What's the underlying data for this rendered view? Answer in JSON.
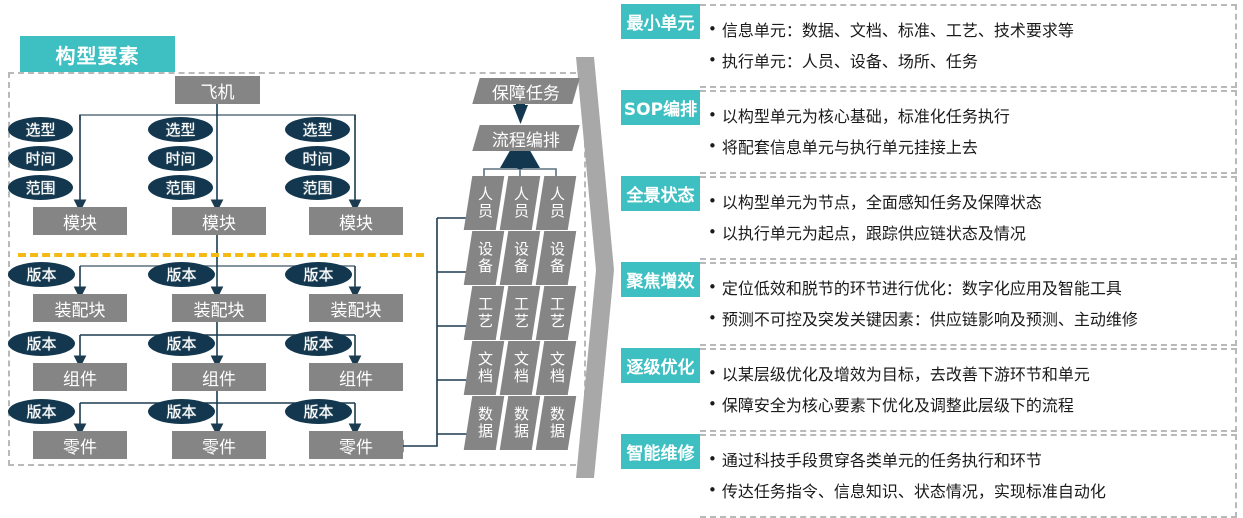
{
  "left_panel": {
    "title": "构型要素",
    "root": {
      "label": "飞机"
    },
    "attribute_labels": [
      "选型",
      "时间",
      "范围"
    ],
    "version_label": "版本",
    "levels": [
      {
        "name": "module-row",
        "label": "模块",
        "columns": [
          "模块",
          "模块",
          "模块"
        ]
      },
      {
        "name": "assembly-row",
        "label": "装配块",
        "columns": [
          "装配块",
          "装配块",
          "装配块"
        ]
      },
      {
        "name": "component-row",
        "label": "组件",
        "columns": [
          "组件",
          "组件",
          "组件"
        ]
      },
      {
        "name": "part-row",
        "label": "零件",
        "columns": [
          "零件",
          "零件",
          "零件"
        ]
      }
    ],
    "task_header": "保障任务",
    "process_header": "流程编排",
    "resource_stack": [
      "人员",
      "设备",
      "工艺",
      "文档",
      "数据"
    ],
    "resource_columns": 3
  },
  "right_panel": {
    "rows": [
      {
        "tag": "最小单元",
        "bullets": [
          "信息单元：数据、文档、标准、工艺、技术要求等",
          "执行单元：人员、设备、场所、任务"
        ]
      },
      {
        "tag": "SOP编排",
        "bullets": [
          "以构型单元为核心基础，标准化任务执行",
          "将配套信息单元与执行单元挂接上去"
        ]
      },
      {
        "tag": "全景状态",
        "bullets": [
          "以构型单元为节点，全面感知任务及保障状态",
          "以执行单元为起点，跟踪供应链状态及情况"
        ]
      },
      {
        "tag": "聚焦增效",
        "bullets": [
          "定位低效和脱节的环节进行优化：数字化应用及智能工具",
          "预测不可控及突发关键因素：供应链影响及预测、主动维修"
        ]
      },
      {
        "tag": "逐级优化",
        "bullets": [
          "以某层级优化及增效为目标，去改善下游环节和单元",
          "保障安全为核心要素下优化及调整此层级下的流程"
        ]
      },
      {
        "tag": "智能维修",
        "bullets": [
          "通过科技手段贯穿各类单元的任务执行和环节",
          "传达任务指令、信息知识、状态情况，实现标准自动化"
        ]
      }
    ],
    "bullet_glyph": "•"
  },
  "colors": {
    "accent_teal": "#3ebfc2",
    "node_navy": "#12374e",
    "box_gray": "#858585",
    "divider_yellow": "#f5b914",
    "arrow_gray": "#a8a8a8",
    "dashed_border": "#b9b9b9",
    "wire": "#1b3c50"
  }
}
